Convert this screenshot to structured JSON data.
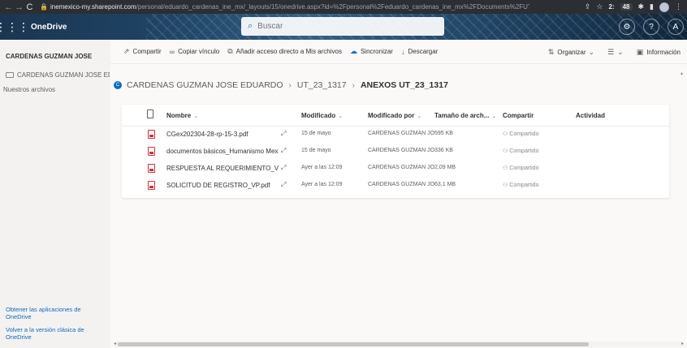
{
  "browser": {
    "url_host": "inemexico-my.sharepoint.com",
    "url_path": "/personal/eduardo_cardenas_ine_mx/_layouts/15/onedrive.aspx?id=%2Fpersonal%2Feduardo_cardenas_ine_mx%2FDocuments%2FUT_23_1317%2FA...",
    "badge_count": "2:",
    "badge_count2": "48"
  },
  "header": {
    "app_name": "OneDrive",
    "search_placeholder": "Buscar"
  },
  "sidebar": {
    "user_name": "CARDENAS GUZMAN JOSE",
    "folder_label": "CARDENAS GUZMAN JOSE EDUARDO",
    "shared_label": "Nuestros archivos",
    "get_apps_link": "Obtener las aplicaciones de OneDrive",
    "classic_link": "Volver a la versión clásica de OneDrive"
  },
  "commands": {
    "share": "Compartir",
    "copy_link": "Copiar vínculo",
    "add_shortcut": "Añadir acceso directo a Mis archivos",
    "sync": "Sincronizar",
    "download": "Descargar",
    "sort": "Organizar",
    "view_icon": "list-view-icon",
    "info": "Información"
  },
  "breadcrumb": {
    "root": "CARDENAS GUZMAN JOSE EDUARDO",
    "parent": "UT_23_1317",
    "current": "ANEXOS UT_23_1317",
    "avatar_initial": "C"
  },
  "table": {
    "columns": {
      "name": "Nombre",
      "modified": "Modificado",
      "modified_by": "Modificado por",
      "size": "Tamaño de arch...",
      "sharing": "Compartir",
      "activity": "Actividad"
    },
    "rows": [
      {
        "name": "CGex202304-28-rp-15-3.pdf",
        "modified": "15 de mayo",
        "modified_by": "CARDENAS GUZMAN JOS",
        "size": "595 KB",
        "sharing": "Compartido"
      },
      {
        "name": "documentos básicos_Humanismo Mexica...",
        "modified": "15 de mayo",
        "modified_by": "CARDENAS GUZMAN JOS",
        "size": "336 KB",
        "sharing": "Compartido"
      },
      {
        "name": "RESPUESTA AL REQUERIMIENTO_VP.pdf",
        "modified": "Ayer a las 12:09",
        "modified_by": "CARDENAS GUZMAN JOS",
        "size": "2,09 MB",
        "sharing": "Compartido"
      },
      {
        "name": "SOLICITUD DE REGISTRO_VP.pdf",
        "modified": "Ayer a las 12:09",
        "modified_by": "CARDENAS GUZMAN JOS",
        "size": "63,1 MB",
        "sharing": "Compartido"
      }
    ]
  },
  "colors": {
    "accent": "#0f6cbd",
    "pdf_red": "#d13438",
    "suitebar_dark": "#1b3650"
  }
}
